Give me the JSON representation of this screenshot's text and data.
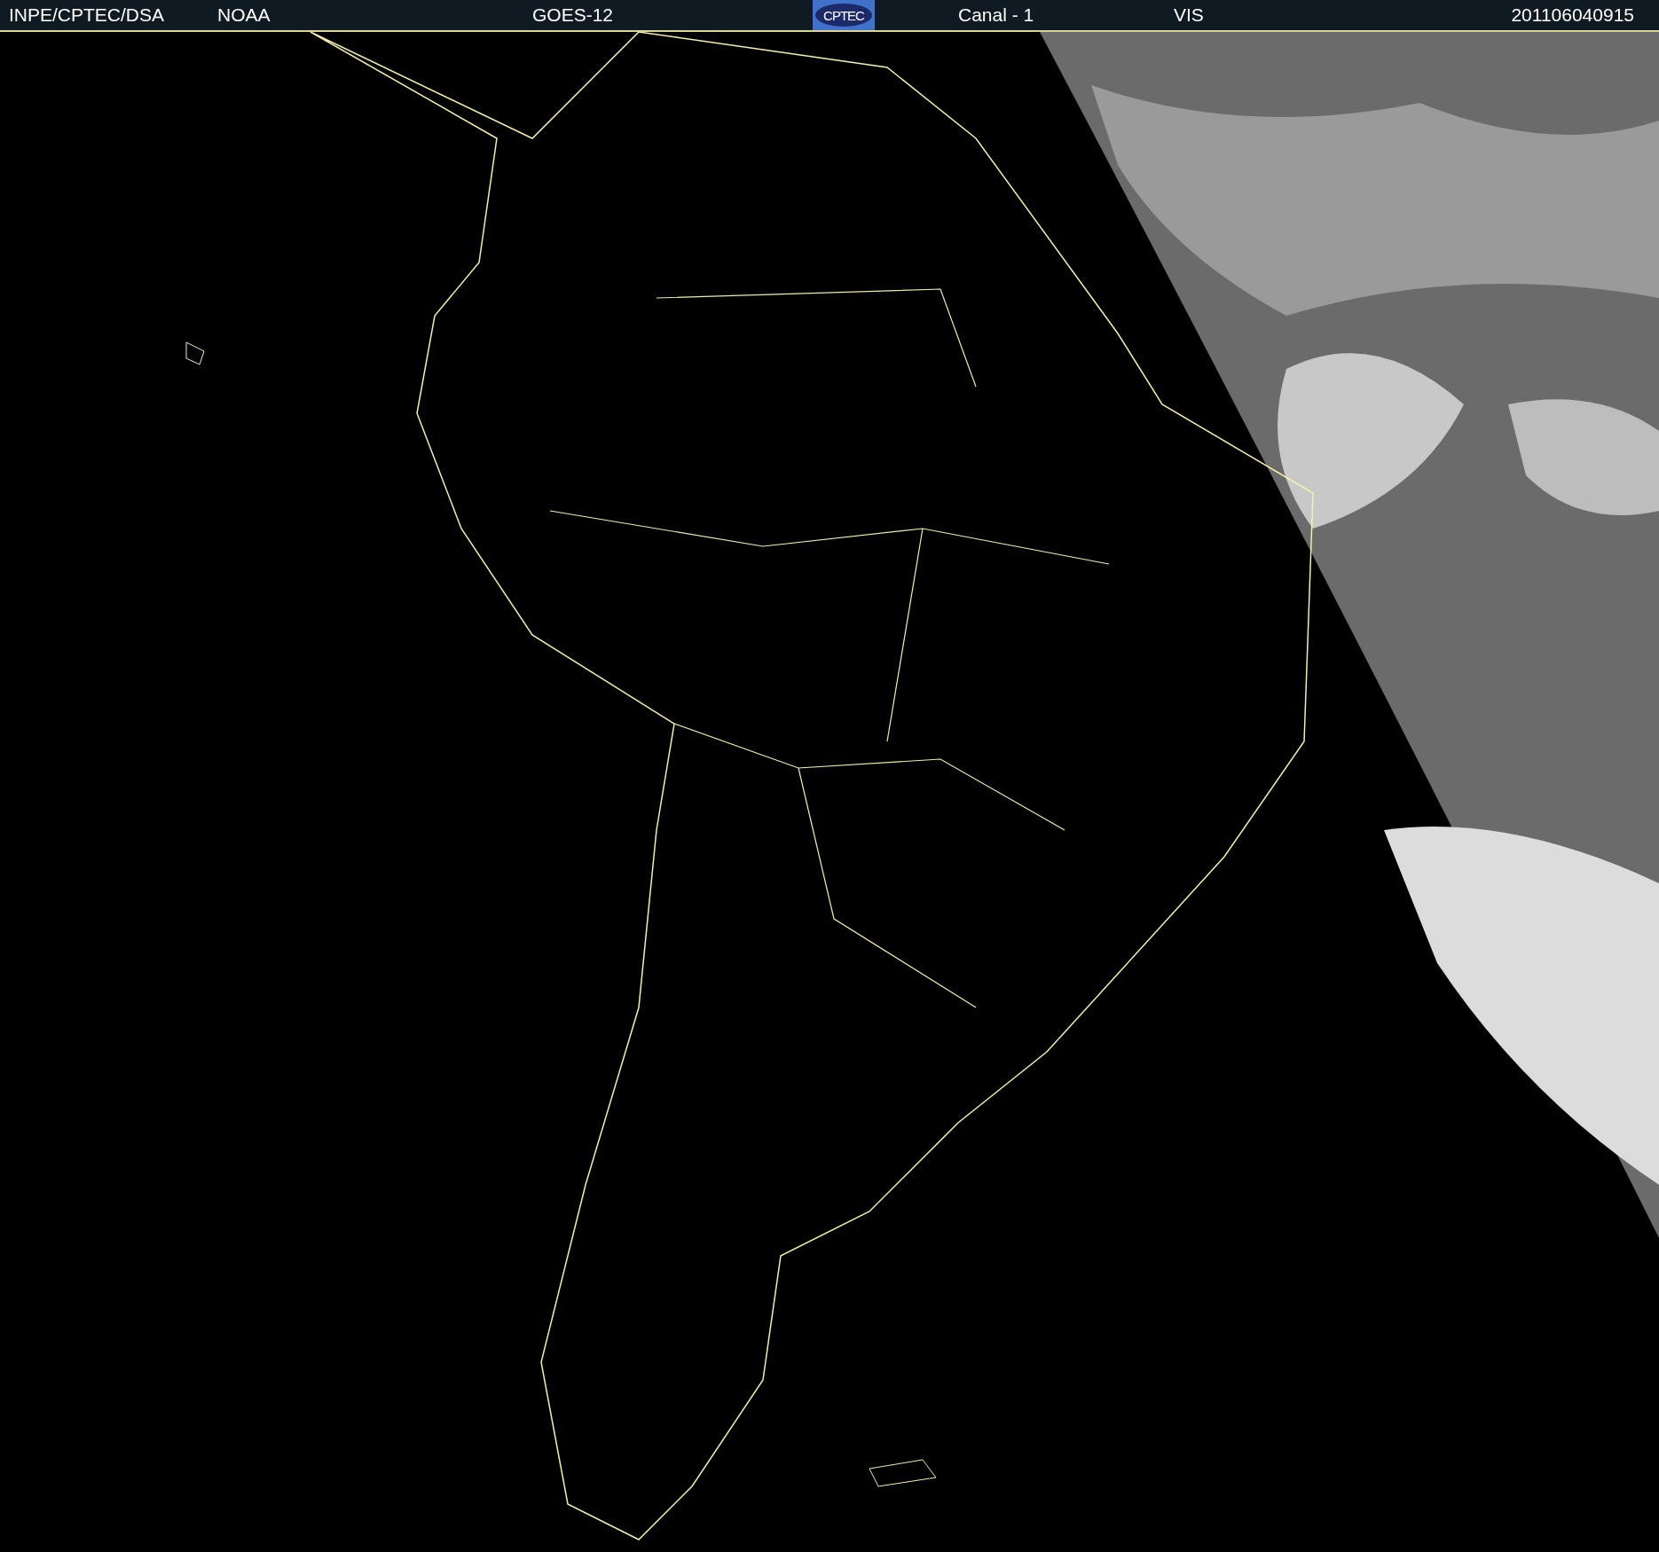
{
  "header": {
    "items": [
      {
        "kind": "text",
        "text": "INPE/CPTEC/DSA"
      },
      {
        "kind": "text",
        "text": "NOAA"
      },
      {
        "kind": "text",
        "text": "GOES-12"
      },
      {
        "kind": "logo",
        "text": "CPTEC"
      },
      {
        "kind": "text",
        "text": "Canal - 1"
      },
      {
        "kind": "text",
        "text": "VIS"
      },
      {
        "kind": "text",
        "text": "201106040915"
      }
    ]
  }
}
